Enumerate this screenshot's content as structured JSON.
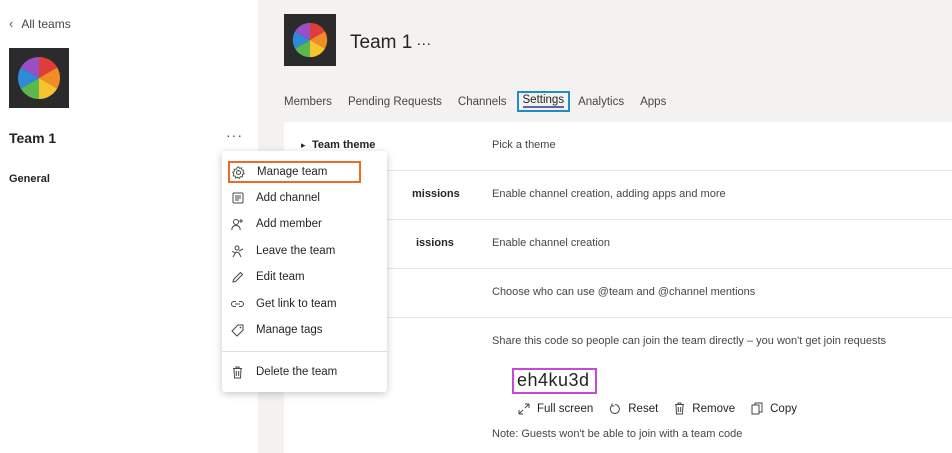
{
  "sidebar": {
    "back_label": "All teams",
    "team_name": "Team 1",
    "more_label": "···",
    "channels": [
      "General"
    ]
  },
  "header": {
    "team_name": "Team 1",
    "more_label": "···"
  },
  "tabs": [
    "Members",
    "Pending Requests",
    "Channels",
    "Settings",
    "Analytics",
    "Apps"
  ],
  "active_tab": "Settings",
  "settings": {
    "rows": [
      {
        "label": "Team theme",
        "desc": "Pick a theme"
      },
      {
        "label": "missions",
        "desc": "Enable channel creation, adding apps and more"
      },
      {
        "label": "issions",
        "desc": "Enable channel creation"
      },
      {
        "label": "",
        "desc": "Choose who can use @team and @channel mentions"
      },
      {
        "label": "",
        "desc": "Share this code so people can join the team directly – you won't get join requests"
      }
    ],
    "team_code": "eh4ku3d",
    "code_actions": {
      "full_screen": "Full screen",
      "reset": "Reset",
      "remove": "Remove",
      "copy": "Copy"
    },
    "note": "Note: Guests won't be able to join with a team code"
  },
  "menu": {
    "items": [
      {
        "label": "Manage team",
        "icon": "gear-icon"
      },
      {
        "label": "Add channel",
        "icon": "channel-icon"
      },
      {
        "label": "Add member",
        "icon": "add-person-icon"
      },
      {
        "label": "Leave the team",
        "icon": "leave-icon"
      },
      {
        "label": "Edit team",
        "icon": "pencil-icon"
      },
      {
        "label": "Get link to team",
        "icon": "link-icon"
      },
      {
        "label": "Manage tags",
        "icon": "tag-icon"
      },
      {
        "label": "Delete the team",
        "icon": "trash-icon"
      }
    ]
  },
  "colors": {
    "highlight_menu": "#e96d25",
    "highlight_tab": "#1e8cc5",
    "highlight_code": "#c34bd8",
    "tab_underline": "#6264a7"
  }
}
